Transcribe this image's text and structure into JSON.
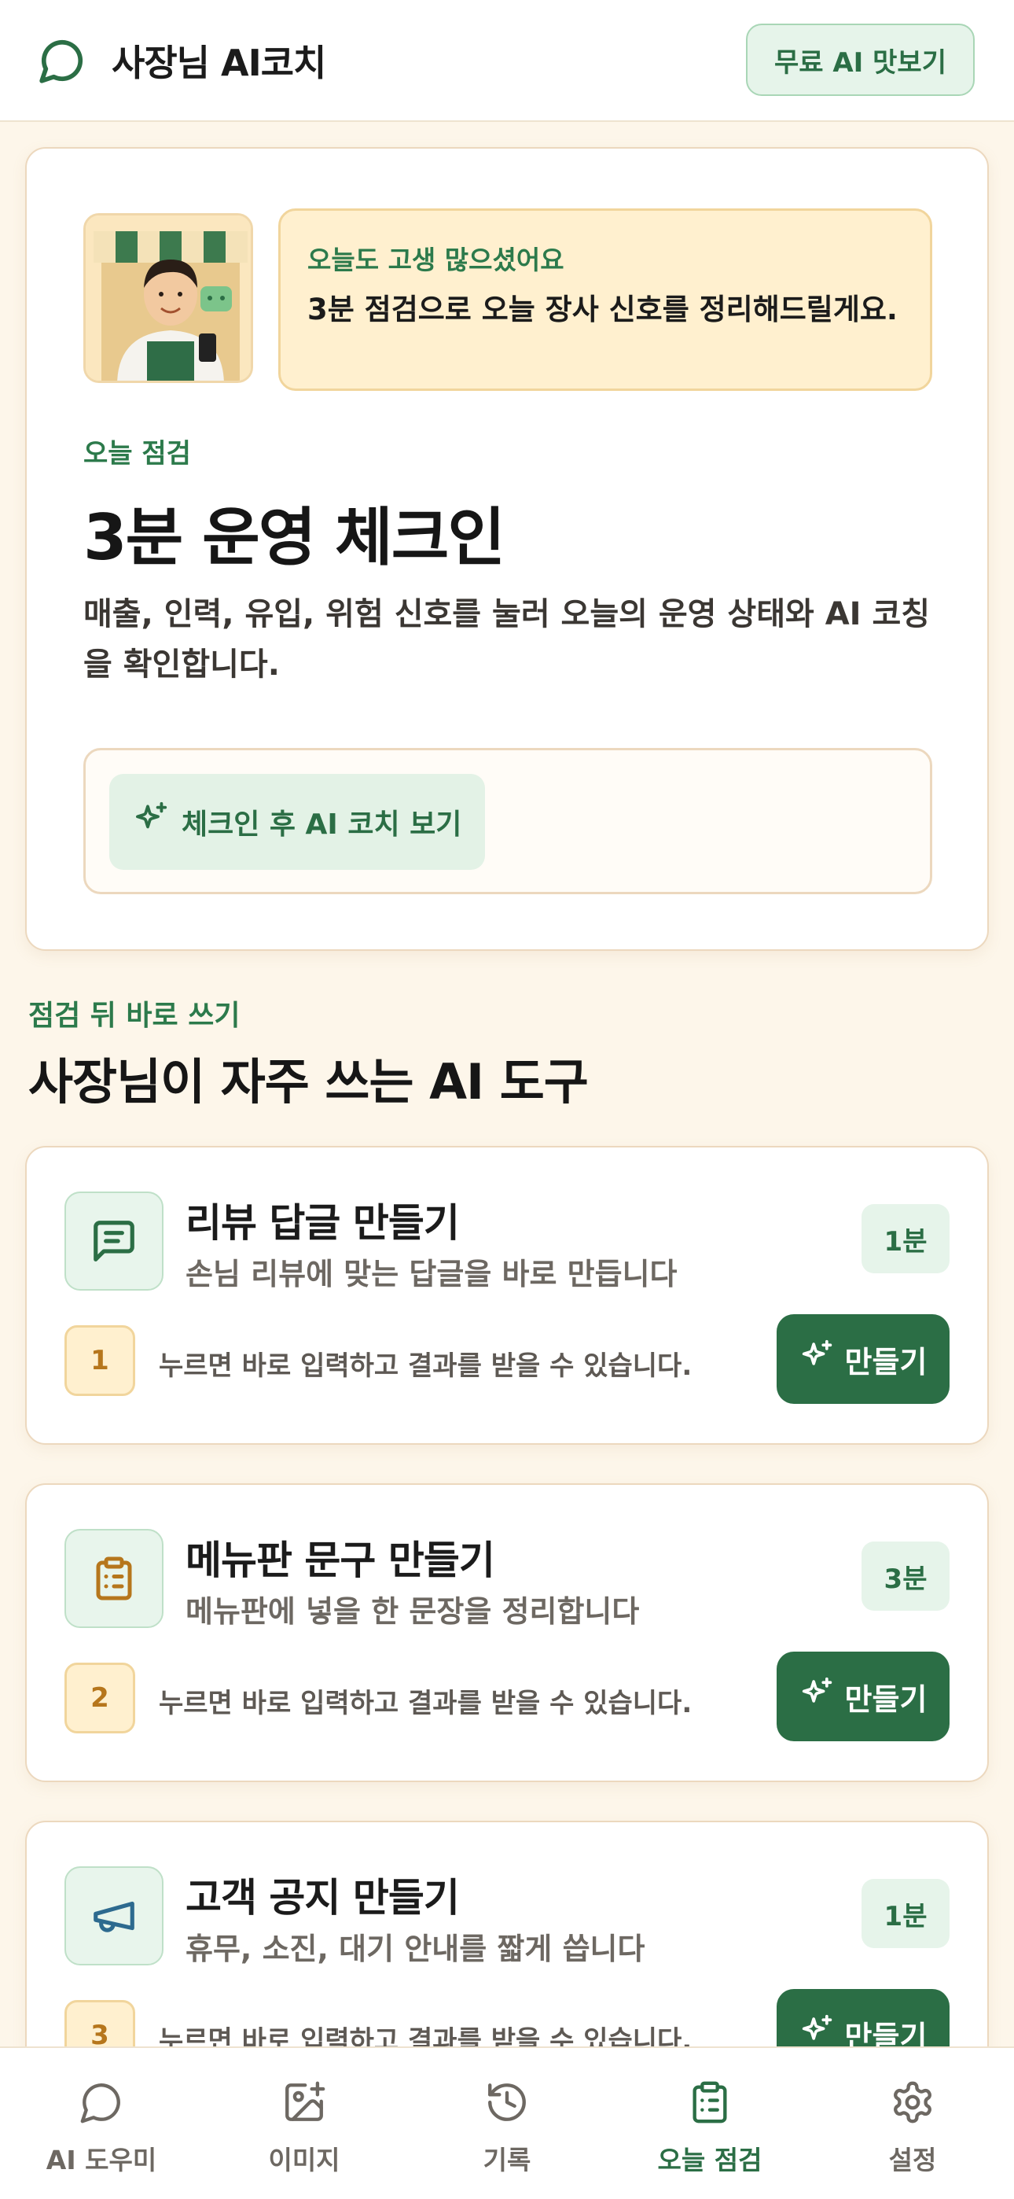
{
  "header": {
    "app_title": "사장님 AI코치",
    "trial_button": "무료 AI 맛보기"
  },
  "hero": {
    "bubble_title": "오늘도 고생 많으셨어요",
    "bubble_body": "3분 점검으로 오늘 장사 신호를 정리해드릴게요.",
    "eyebrow": "오늘 점검",
    "title": "3분 운영 체크인",
    "description": "매출, 인력, 유입, 위험 신호를 눌러 오늘의 운영 상태와 AI 코칭을 확인합니다.",
    "cta": "체크인 후 AI 코치 보기"
  },
  "tools_section": {
    "eyebrow": "점검 뒤 바로 쓰기",
    "title": "사장님이 자주 쓰는 AI 도구",
    "items": [
      {
        "name": "리뷰 답글 만들기",
        "desc": "손님 리뷰에 맞는 답글을 바로 만듭니다",
        "time": "1분",
        "step": "1",
        "hint": "누르면 바로 입력하고 결과를 받을 수 있습니다.",
        "button": "만들기",
        "icon": "message-icon"
      },
      {
        "name": "메뉴판 문구 만들기",
        "desc": "메뉴판에 넣을 한 문장을 정리합니다",
        "time": "3분",
        "step": "2",
        "hint": "누르면 바로 입력하고 결과를 받을 수 있습니다.",
        "button": "만들기",
        "icon": "clipboard-icon"
      },
      {
        "name": "고객 공지 만들기",
        "desc": "휴무, 소진, 대기 안내를 짧게 씁니다",
        "time": "1분",
        "step": "3",
        "hint": "누르면 바로 입력하고 결과를 받을 수 있습니다.",
        "button": "만들기",
        "icon": "megaphone-icon"
      }
    ]
  },
  "bottom_nav": {
    "items": [
      {
        "label": "AI 도우미",
        "icon": "chat-icon",
        "active": false
      },
      {
        "label": "이미지",
        "icon": "image-plus-icon",
        "active": false
      },
      {
        "label": "기록",
        "icon": "history-icon",
        "active": false
      },
      {
        "label": "오늘 점검",
        "icon": "clipboard-icon",
        "active": true
      },
      {
        "label": "설정",
        "icon": "gear-icon",
        "active": false
      }
    ]
  },
  "colors": {
    "brand": "#2b6e45",
    "background": "#fdf6ea",
    "accent_yellow": "#fff0cf"
  }
}
